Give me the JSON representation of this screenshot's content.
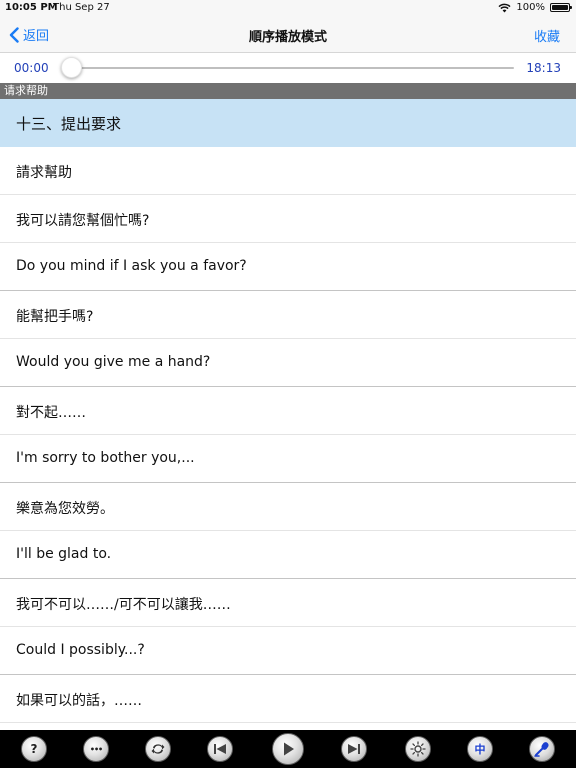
{
  "status": {
    "time": "10:05 PM",
    "date": "Thu Sep 27",
    "battery": "100%"
  },
  "nav": {
    "back_label": "返回",
    "title": "順序播放模式",
    "favorite_label": "收藏"
  },
  "player": {
    "current_time": "00:00",
    "total_time": "18:13",
    "progress": 0
  },
  "section": {
    "header": "请求帮助"
  },
  "rows": [
    "十三、提出要求",
    "請求幫助",
    "我可以請您幫個忙嗎?",
    "Do you mind if I ask you a favor?",
    "能幫把手嗎?",
    "Would you give me a hand?",
    "對不起……",
    "I'm sorry to bother you,...",
    "樂意為您效勞。",
    "I'll be glad to.",
    "我可不可以……/可不可以讓我……",
    "Could I possibly...?",
    "如果可以的話，……"
  ],
  "toolbar": {
    "help_symbol": "?",
    "more_symbol": "•••",
    "chinese_symbol": "中",
    "icons": [
      "help-icon",
      "more-icon",
      "repeat-icon",
      "previous-icon",
      "play-icon",
      "next-icon",
      "brightness-icon",
      "chinese-mode-icon",
      "record-icon"
    ]
  },
  "colors": {
    "accent": "#1a7cf5",
    "selected_row": "#c7e2f5",
    "section_header": "#707070",
    "time_text": "#2341b8"
  }
}
